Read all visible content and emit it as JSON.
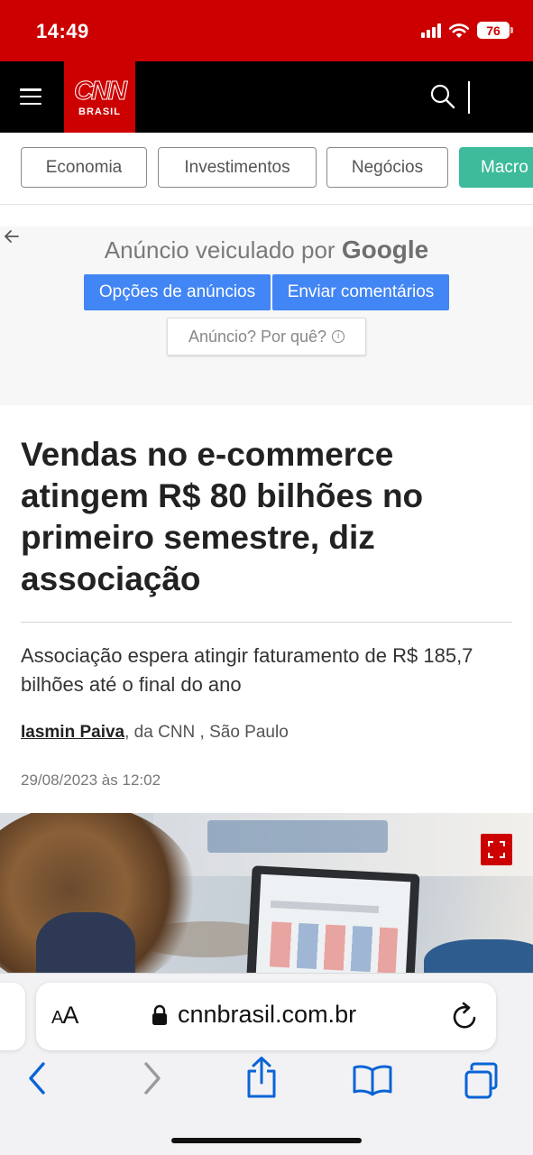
{
  "status_bar": {
    "time": "14:49",
    "battery": "76",
    "colors": {
      "background": "#cc0000"
    }
  },
  "header": {
    "logo_main": "CNN",
    "logo_sub": "BRASIL",
    "icons": [
      "menu-icon",
      "search-icon"
    ]
  },
  "categories": [
    {
      "label": "Economia"
    },
    {
      "label": "Investimentos"
    },
    {
      "label": "Negócios"
    },
    {
      "label": "Macro",
      "active": true
    }
  ],
  "ad": {
    "title_prefix": "Anúncio veiculado por",
    "title_brand": "Google",
    "options_label": "Opções de anúncios",
    "feedback_label": "Enviar comentários",
    "why_label": "Anúncio? Por quê?"
  },
  "article": {
    "headline": "Vendas no e-commerce atingem R$ 80 bilhões no primeiro semestre, diz associação",
    "subtitle": "Associação espera atingir faturamento de R$ 185,7 bilhões até o final do ano",
    "author": "Iasmin Paiva",
    "byline_rest": ", da CNN , São Paulo",
    "date": "29/08/2023 às 12:02"
  },
  "browser": {
    "aa_small": "A",
    "aa_large": "A",
    "url": "cnnbrasil.com.br",
    "toolbar_icons": [
      "back-icon",
      "forward-icon",
      "share-icon",
      "bookmarks-icon",
      "tabs-icon"
    ],
    "accent_color": "#0a64d6"
  },
  "colors": {
    "cnn_red": "#cc0000",
    "active_pill": "#3dbb9b",
    "ad_button": "#4285f4"
  }
}
